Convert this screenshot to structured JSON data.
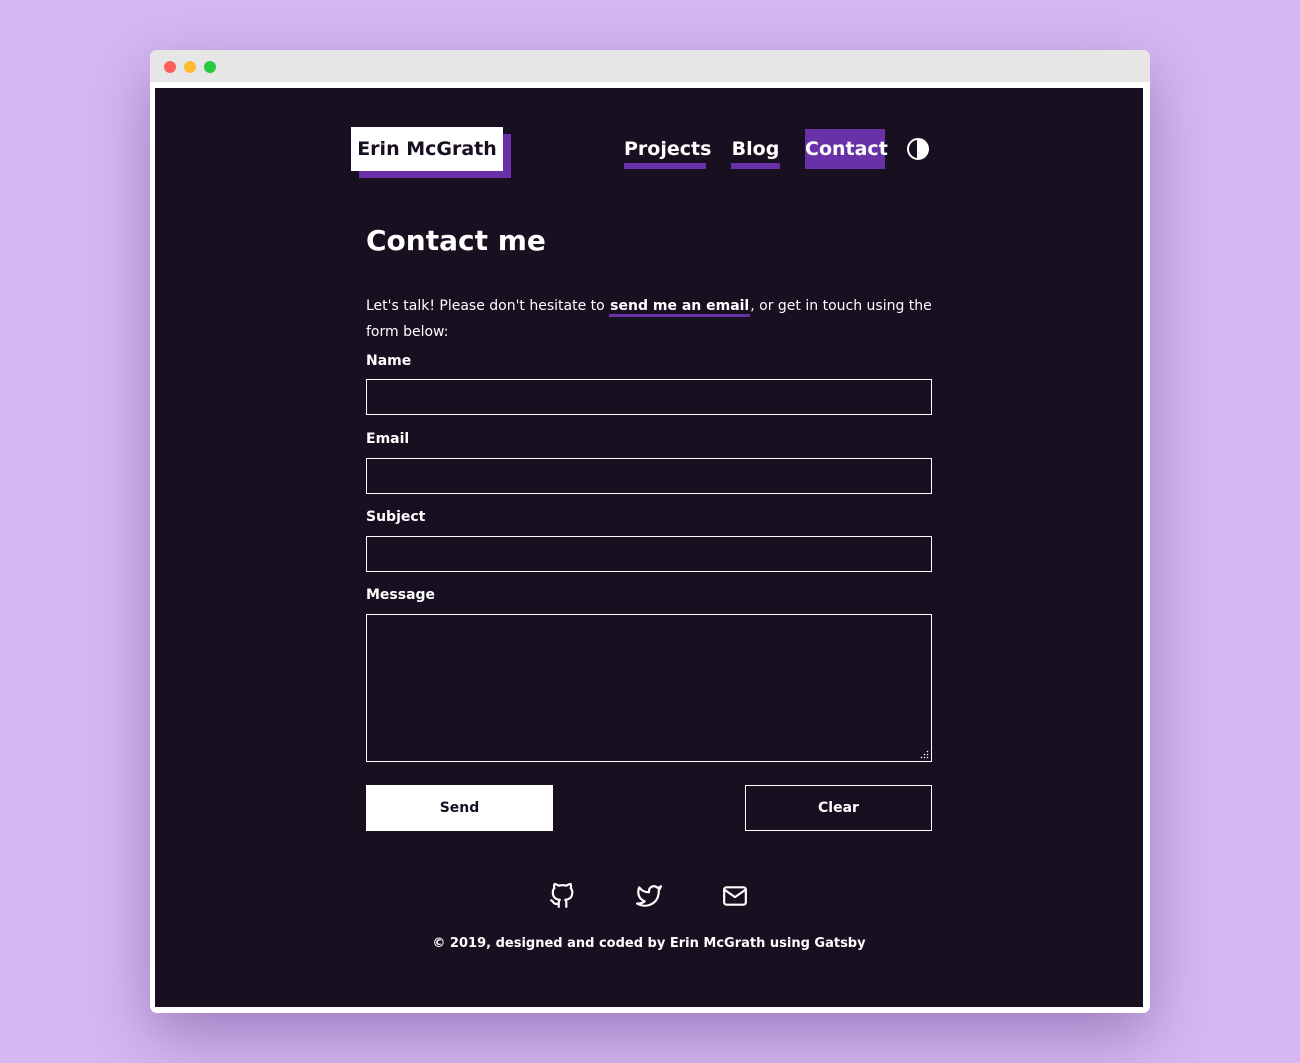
{
  "site": {
    "logo": "Erin McGrath"
  },
  "nav": {
    "projects": "Projects",
    "blog": "Blog",
    "contact": "Contact"
  },
  "icons": {
    "theme_toggle": "contrast-icon",
    "github": "github-icon",
    "twitter": "twitter-icon",
    "email": "mail-icon"
  },
  "page": {
    "title": "Contact me",
    "intro_before": "Let's talk! Please don't hesitate to ",
    "intro_link": "send me an email",
    "intro_after": ", or get in touch using the form below:"
  },
  "form": {
    "name_label": "Name",
    "email_label": "Email",
    "subject_label": "Subject",
    "message_label": "Message",
    "name_value": "",
    "email_value": "",
    "subject_value": "",
    "message_value": "",
    "send_label": "Send",
    "clear_label": "Clear"
  },
  "footer": {
    "text": "© 2019, designed and coded by Erin McGrath using Gatsby"
  },
  "colors": {
    "background": "#d5b8f1",
    "page": "#180f20",
    "accent": "#6931a7",
    "text": "#ffffff"
  }
}
